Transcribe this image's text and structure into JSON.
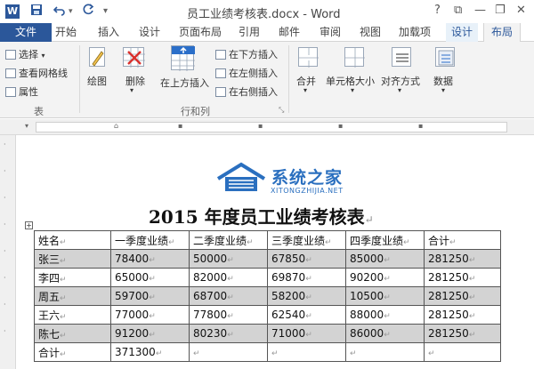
{
  "titlebar": {
    "word_icon": "W",
    "title": "员工业绩考核表.docx - Word",
    "help": "?",
    "ribbon_options": "⧉",
    "minimize": "—",
    "restore": "❐",
    "close": "✕"
  },
  "tabs": {
    "file": "文件",
    "start": "开始",
    "insert": "插入",
    "design": "设计",
    "layout": "页面布局",
    "references": "引用",
    "mail": "邮件",
    "review": "审阅",
    "view": "视图",
    "addins": "加载项",
    "table_design": "设计",
    "table_layout": "布局"
  },
  "ribbon": {
    "select": "选择",
    "view_gridlines": "查看网格线",
    "properties": "属性",
    "group_table": "表",
    "draw": "绘图",
    "delete": "删除",
    "insert_above": "在上方插入",
    "insert_below": "在下方插入",
    "insert_left": "在左侧插入",
    "insert_right": "在右侧插入",
    "group_rows_cols": "行和列",
    "merge": "合并",
    "cell_size": "单元格大小",
    "alignment": "对齐方式",
    "data": "数据"
  },
  "logo": {
    "brand": "系统之家",
    "url": "XITONGZHIJIA.NET"
  },
  "document": {
    "title": "2015 年度员工业绩考核表",
    "headers": [
      "姓名",
      "一季度业绩",
      "二季度业绩",
      "三季度业绩",
      "四季度业绩",
      "合计"
    ],
    "rows": [
      {
        "name": "张三",
        "q1": "78400",
        "q2": "50000",
        "q3": "67850",
        "q4": "85000",
        "total": "281250",
        "highlight": true
      },
      {
        "name": "李四",
        "q1": "65000",
        "q2": "82000",
        "q3": "69870",
        "q4": "90200",
        "total": "281250",
        "highlight": false
      },
      {
        "name": "周五",
        "q1": "59700",
        "q2": "68700",
        "q3": "58200",
        "q4": "10500",
        "total": "281250",
        "highlight": true
      },
      {
        "name": "王六",
        "q1": "77000",
        "q2": "77800",
        "q3": "62540",
        "q4": "88000",
        "total": "281250",
        "highlight": false
      },
      {
        "name": "陈七",
        "q1": "91200",
        "q2": "80230",
        "q3": "71000",
        "q4": "86000",
        "total": "281250",
        "highlight": true
      }
    ],
    "footer": {
      "label": "合计",
      "value": "371300"
    }
  },
  "colors": {
    "word_blue": "#2b579a",
    "table_highlight": "#d3d3d3"
  }
}
